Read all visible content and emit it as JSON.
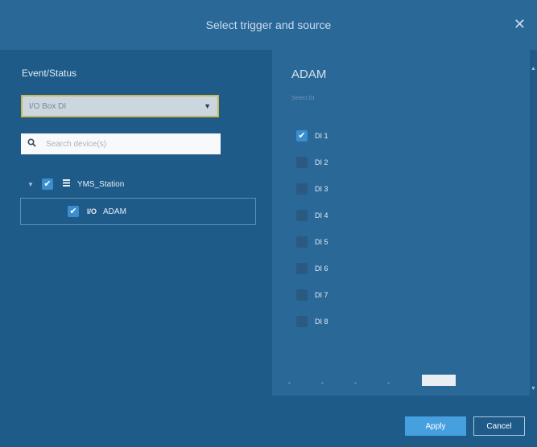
{
  "dialog": {
    "title": "Select trigger and source",
    "close_symbol": "✕"
  },
  "left": {
    "section_label": "Event/Status",
    "dropdown": {
      "value": "I/O Box DI",
      "caret": "▼"
    },
    "search": {
      "placeholder": "Search device(s)"
    },
    "tree": {
      "group": {
        "label": "YMS_Station",
        "checked": true
      },
      "device": {
        "prefix": "I/O",
        "label": "ADAM",
        "checked": true,
        "selected": true
      }
    }
  },
  "right": {
    "device_title": "ADAM",
    "subtitle": "Select DI",
    "inputs": [
      {
        "label": "DI 1",
        "checked": true
      },
      {
        "label": "DI 2",
        "checked": false
      },
      {
        "label": "DI 3",
        "checked": false
      },
      {
        "label": "DI 4",
        "checked": false
      },
      {
        "label": "DI 5",
        "checked": false
      },
      {
        "label": "DI 6",
        "checked": false
      },
      {
        "label": "DI 7",
        "checked": false
      },
      {
        "label": "DI 8",
        "checked": false
      }
    ]
  },
  "footer": {
    "apply_label": "Apply",
    "cancel_label": "Cancel"
  },
  "colors": {
    "background": "#1f5b89",
    "header": "#2a6898",
    "accent_checkbox": "#3a8ed0",
    "apply_button": "#46a0df",
    "dropdown_border": "#c9b85a"
  }
}
